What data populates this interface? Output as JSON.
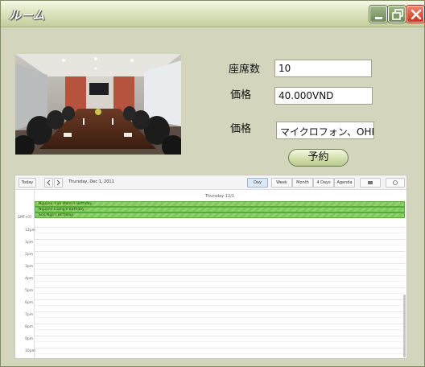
{
  "window": {
    "title": "ルーム",
    "minimize_icon": "minimize-icon",
    "maximize_icon": "restore-icon",
    "close_icon": "close-icon"
  },
  "room": {
    "seats_label": "座席数",
    "seats_value": "10",
    "price_label": "価格",
    "price_value": "40.000VND",
    "equipment_label": "価格",
    "equipment_value": "マイクロフォン、OHP.",
    "reserve_button": "予約"
  },
  "calendar": {
    "today_button": "Today",
    "prev_icon": "chevron-left-icon",
    "next_icon": "chevron-right-icon",
    "current_date": "Thursday, Dec 1, 2011",
    "views": [
      "Day",
      "Week",
      "Month",
      "4 Days",
      "Agenda"
    ],
    "active_view": "Day",
    "print_icon": "print-icon",
    "refresh_icon": "refresh-icon",
    "day_header": "Thursday 12/1",
    "timezone": "GMT+07",
    "all_day_events": [
      "Nguyen Tran Manh's Birthday",
      "Nguyen Luong's Birthday",
      "Son Ngo's Birthday"
    ],
    "time_labels": [
      "12pm",
      "1pm",
      "2pm",
      "3pm",
      "4pm",
      "5pm",
      "6pm",
      "7pm",
      "8pm",
      "9pm",
      "10pm"
    ]
  }
}
